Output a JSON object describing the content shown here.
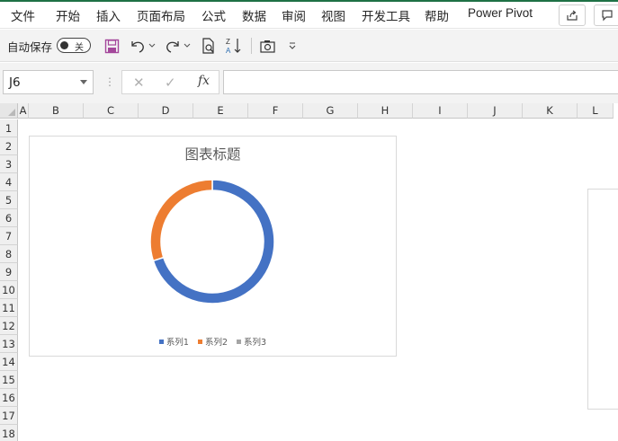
{
  "ribbon": {
    "tabs": [
      {
        "label": "文件"
      },
      {
        "label": "开始"
      },
      {
        "label": "插入"
      },
      {
        "label": "页面布局"
      },
      {
        "label": "公式"
      },
      {
        "label": "数据"
      },
      {
        "label": "审阅"
      },
      {
        "label": "视图"
      },
      {
        "label": "开发工具"
      },
      {
        "label": "帮助"
      },
      {
        "label": "Power Pivot"
      }
    ],
    "right_buttons": [
      "share-icon",
      "comment-icon"
    ],
    "accent_color": "#1e7145"
  },
  "quick_access": {
    "autosave_label": "自动保存",
    "autosave_state": "关",
    "icons": [
      "save-icon",
      "undo-icon",
      "redo-icon",
      "print-preview-icon",
      "sort-az-icon",
      "camera-icon",
      "customize-toolbar-icon"
    ]
  },
  "formula_bar": {
    "name_box": "J6",
    "fx_label": "fx",
    "formula": ""
  },
  "sheet": {
    "columns": [
      "A",
      "B",
      "C",
      "D",
      "E",
      "F",
      "G",
      "H",
      "I",
      "J",
      "K",
      "L"
    ],
    "rows": [
      "1",
      "2",
      "3",
      "4",
      "5",
      "6",
      "7",
      "8",
      "9",
      "10",
      "11",
      "12",
      "13",
      "14",
      "15",
      "16",
      "17",
      "18"
    ]
  },
  "chart_data": {
    "type": "pie",
    "subtype": "doughnut",
    "title": "图表标题",
    "series": [
      {
        "name": "系列1",
        "values": [
          0.7
        ],
        "color": "#4472c4"
      },
      {
        "name": "系列2",
        "values": [
          0.3
        ],
        "color": "#ed7d31"
      },
      {
        "name": "系列3",
        "values": [
          0
        ],
        "color": "#a5a5a5"
      }
    ],
    "legend_position": "bottom"
  }
}
